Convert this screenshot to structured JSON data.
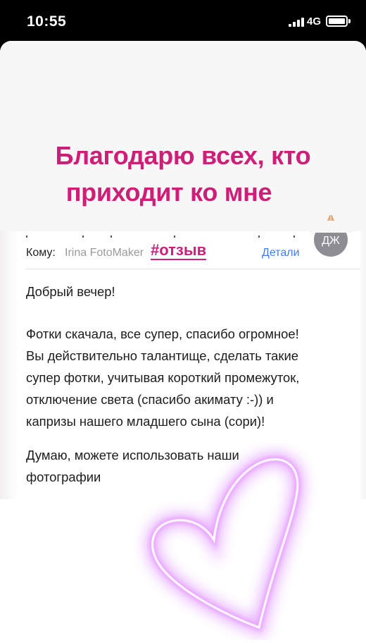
{
  "status_bar": {
    "time": "10:55",
    "network": "4G"
  },
  "story": {
    "headline_line1": "Благодарю всех, кто",
    "headline_line2": "приходит ко мне",
    "accent_color": "#cf1e78",
    "sticker_icon": "heart-outline-icon"
  },
  "email": {
    "to_label": "Кому:",
    "to_value": "Irina FotoMaker",
    "hashtag": "#отзыв",
    "details_label": "Детали",
    "avatar_initials": "ДЖ",
    "body_lines": [
      "Добрый вечер!",
      "Фотки скачала, все супер, спасибо огромное!",
      "Вы действительно талантище, сделать такие",
      "супер фотки, учитывая короткий промежуток,",
      "отключение света (спасибо акимату :-)) и",
      "капризы нашего младшего сына (сори)!",
      "Думаю, можете использовать наши",
      "фотографии"
    ]
  }
}
